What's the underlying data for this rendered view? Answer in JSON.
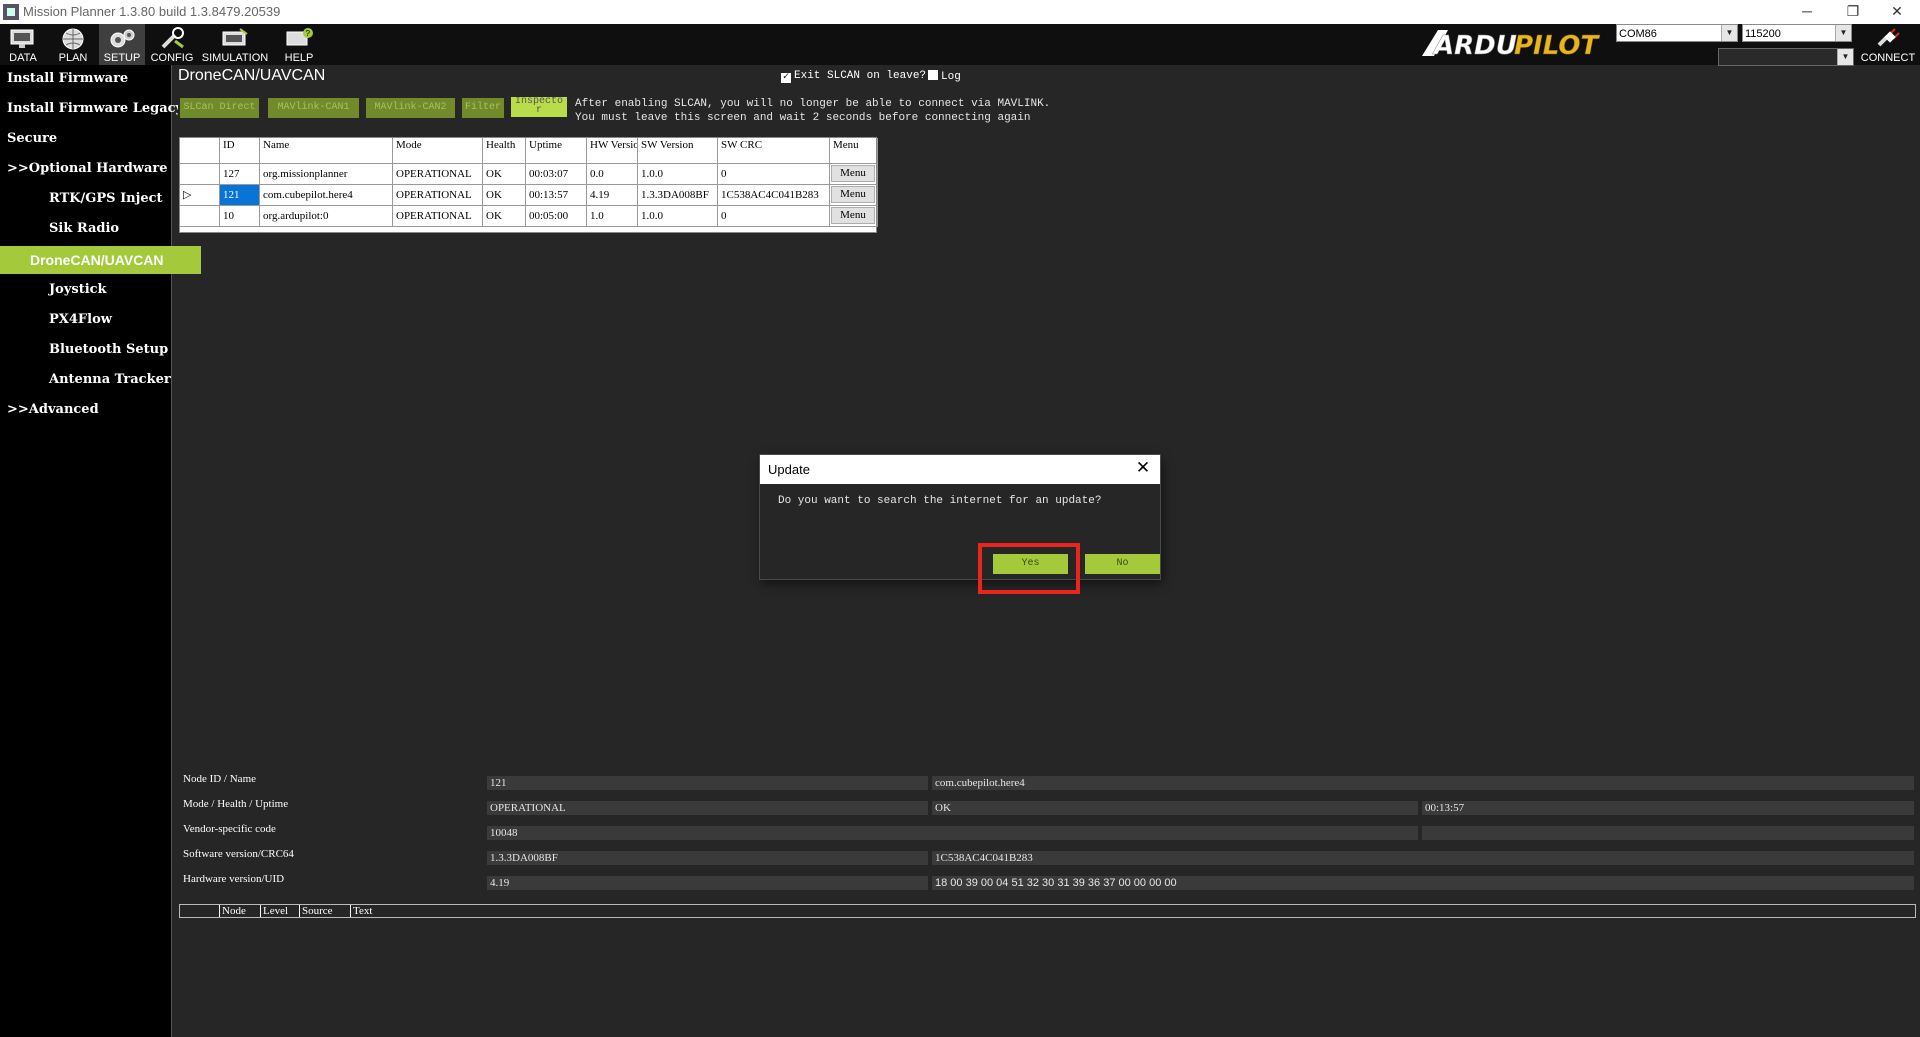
{
  "window": {
    "title": "Mission Planner 1.3.80 build 1.3.8479.20539",
    "controls": [
      "─",
      "❐",
      "✕"
    ]
  },
  "toolbar": {
    "buttons": [
      {
        "label": "DATA",
        "icon": "monitor-icon"
      },
      {
        "label": "PLAN",
        "icon": "globe-icon"
      },
      {
        "label": "SETUP",
        "icon": "gears-icon"
      },
      {
        "label": "CONFIG",
        "icon": "wrench-icon"
      },
      {
        "label": "SIMULATION",
        "icon": "simulation-icon"
      },
      {
        "label": "HELP",
        "icon": "help-icon"
      }
    ],
    "active": "SETUP",
    "logo_text": "ARDUPILOT",
    "port": "COM86",
    "baud": "115200",
    "connect_label": "CONNECT"
  },
  "sidebar": {
    "items": [
      {
        "label": "Install Firmware"
      },
      {
        "label": "Install Firmware Legacy"
      },
      {
        "label": "Secure"
      },
      {
        "label": ">>Optional Hardware"
      },
      {
        "label": "RTK/GPS Inject"
      },
      {
        "label": "Sik Radio"
      },
      {
        "label": "DroneCAN/UAVCAN"
      },
      {
        "label": "Joystick"
      },
      {
        "label": "PX4Flow"
      },
      {
        "label": "Bluetooth Setup"
      },
      {
        "label": "Antenna Tracker"
      },
      {
        "label": ">>Advanced"
      }
    ],
    "active": "DroneCAN/UAVCAN"
  },
  "main": {
    "title": "DroneCAN/UAVCAN",
    "exit_slcan_label": "Exit SLCAN on leave?",
    "exit_slcan_checked": true,
    "log_label": "Log",
    "log_checked": false,
    "buttons": {
      "slcan_direct": "SLCan Direct",
      "mavlink_can1": "MAVlink-CAN1",
      "mavlink_can2": "MAVlink-CAN2",
      "filter": "Filter",
      "inspector": "Inspecto r"
    },
    "notice_line1": "After enabling SLCAN, you will no longer be able to connect via MAVLINK.",
    "notice_line2": "You must leave this screen and wait 2 seconds before connecting again"
  },
  "node_table": {
    "headers": [
      "ID",
      "Name",
      "Mode",
      "Health",
      "Uptime",
      "HW Version",
      "SW Version",
      "SW CRC",
      "Menu"
    ],
    "rows": [
      {
        "id": "127",
        "name": "org.missionplanner",
        "mode": "OPERATIONAL",
        "health": "OK",
        "uptime": "00:03:07",
        "hw": "0.0",
        "sw": "1.0.0",
        "crc": "0",
        "menu": "Menu",
        "selected": false
      },
      {
        "id": "121",
        "name": "com.cubepilot.here4",
        "mode": "OPERATIONAL",
        "health": "OK",
        "uptime": "00:13:57",
        "hw": "4.19",
        "sw": "1.3.3DA008BF",
        "crc": "1C538AC4C041B283",
        "menu": "Menu",
        "selected": true
      },
      {
        "id": "10",
        "name": "org.ardupilot:0",
        "mode": "OPERATIONAL",
        "health": "OK",
        "uptime": "00:05:00",
        "hw": "1.0",
        "sw": "1.0.0",
        "crc": "0",
        "menu": "Menu",
        "selected": false
      }
    ],
    "selection_marker": "▷"
  },
  "node_info": {
    "labels": {
      "id_name": "Node ID / Name",
      "mode_health_uptime": "Mode / Health / Uptime",
      "vendor_code": "Vendor-specific code",
      "software": "Software version/CRC64",
      "hardware": "Hardware version/UID"
    },
    "node_id": "121",
    "node_name": "com.cubepilot.here4",
    "mode": "OPERATIONAL",
    "health": "OK",
    "uptime": "00:13:57",
    "vendor_code": "10048",
    "sw_version": "1.3.3DA008BF",
    "sw_crc": "1C538AC4C041B283",
    "hw_version": "4.19",
    "hw_uid": "18 00 39 00 04 51 32 30 31 39 36 37 00 00 00 00"
  },
  "log_grid": {
    "headers": [
      "Node",
      "Level",
      "Source",
      "Text"
    ]
  },
  "dialog": {
    "title": "Update",
    "message": "Do you want to search the internet for an update?",
    "yes_label": "Yes",
    "no_label": "No",
    "close_glyph": "✕"
  }
}
